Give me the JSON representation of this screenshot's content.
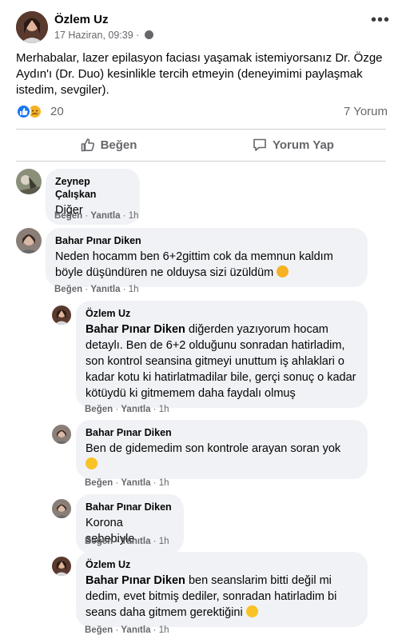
{
  "post": {
    "author": "Özlem Uz",
    "date": "17 Haziran, 09:39",
    "separator": "·",
    "more_label": "•••",
    "text": "Merhabalar, lazer epilasyon faciası yaşamak istemiyorsanız Dr. Özge Aydın'ı (Dr. Duo) kesinlikle tercih etmeyin (deneyimimi paylaşmak istedim, sevgiler).",
    "reaction_count": "20",
    "comment_count": "7 Yorum",
    "like_label": "Beğen",
    "comment_label": "Yorum Yap"
  },
  "comments": [
    {
      "name": "Zeynep Çalışkan",
      "text": "Diğer",
      "like": "Beğen",
      "reply": "Yanıtla",
      "time": "1h"
    },
    {
      "name": "Bahar Pınar Diken",
      "text": "Neden hocamm ben 6+2gittim cok da memnun kaldım böyle düşündüren ne olduysa sizi üzüldüm",
      "like": "Beğen",
      "reply": "Yanıtla",
      "time": "1h"
    }
  ],
  "replies": [
    {
      "name": "Özlem Uz",
      "mention": "Bahar Pınar Diken",
      "text": " diğerden yazıyorum hocam detaylı. Ben de 6+2 olduğunu sonradan hatirladim, son kontrol seansina gitmeyi unuttum iş ahlaklari o kadar kotu ki hatirlatmadilar bile, gerçi sonuç o kadar kötüydü ki gitmemem daha faydalı olmuş",
      "like": "Beğen",
      "reply": "Yanıtla",
      "time": "1h"
    },
    {
      "name": "Bahar Pınar Diken",
      "text": "Ben de gidemedim son kontrole arayan soran yok",
      "like": "Beğen",
      "reply": "Yanıtla",
      "time": "1h"
    },
    {
      "name": "Bahar Pınar Diken",
      "text": "Korona sebebiyle",
      "like": "Beğen",
      "reply": "Yanıtla",
      "time": "1h"
    },
    {
      "name": "Özlem Uz",
      "mention": "Bahar Pınar Diken",
      "text": " ben seanslarim bitti değil mi dedim, evet bitmiş dediler, sonradan hatirladim bi seans daha gitmem gerektiğini",
      "like": "Beğen",
      "reply": "Yanıtla",
      "time": "1h"
    }
  ],
  "colors": {
    "accent": "#1877f2",
    "secondary_text": "#65676b",
    "bubble": "#f0f2f5"
  },
  "icons": {
    "like": "thumbs-up-icon",
    "comment": "speech-bubble-icon",
    "privacy": "globe-icon",
    "reaction_like": "like-reaction-icon",
    "reaction_sad": "sad-reaction-icon"
  }
}
